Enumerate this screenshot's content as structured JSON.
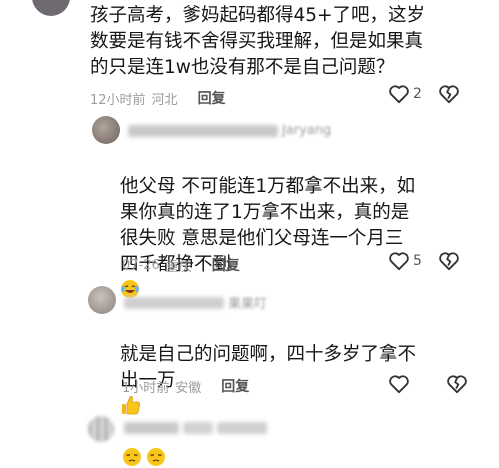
{
  "comment1": {
    "text": "孩子高考，爹妈起码都得45+了吧，这岁\n数要是有钱不舍得买我理解，但是如果真\n的只是连1w也没有那不是自己问题？",
    "time": "12小时前",
    "location": "河北",
    "reply_label": "回复",
    "like_count": "2"
  },
  "comment2": {
    "username_fragment": "Jaryang",
    "text": "他父母  不可能连1万都拿不出来，如\n果你真的连了1万拿不出来，真的是\n很失败  意思是他们父母连一个月三\n四千都挣不到",
    "time": "07-26",
    "location": "重庆",
    "reply_label": "回复",
    "like_count": "5",
    "trailing_emoji": "laughing-tears-emoji"
  },
  "comment3": {
    "username_fragment": "果果叮",
    "text": "就是自己的问题啊，四十多岁了拿不\n出一万",
    "time": "1小时前",
    "location": "安徽",
    "reply_label": "回复",
    "trailing_emoji": "thumbs-up-emoji"
  },
  "comment4": {
    "emojis": [
      "unamused-face-emoji",
      "unamused-face-emoji"
    ]
  },
  "icons": {
    "like": "heart-outline-icon",
    "dislike": "broken-heart-icon"
  }
}
